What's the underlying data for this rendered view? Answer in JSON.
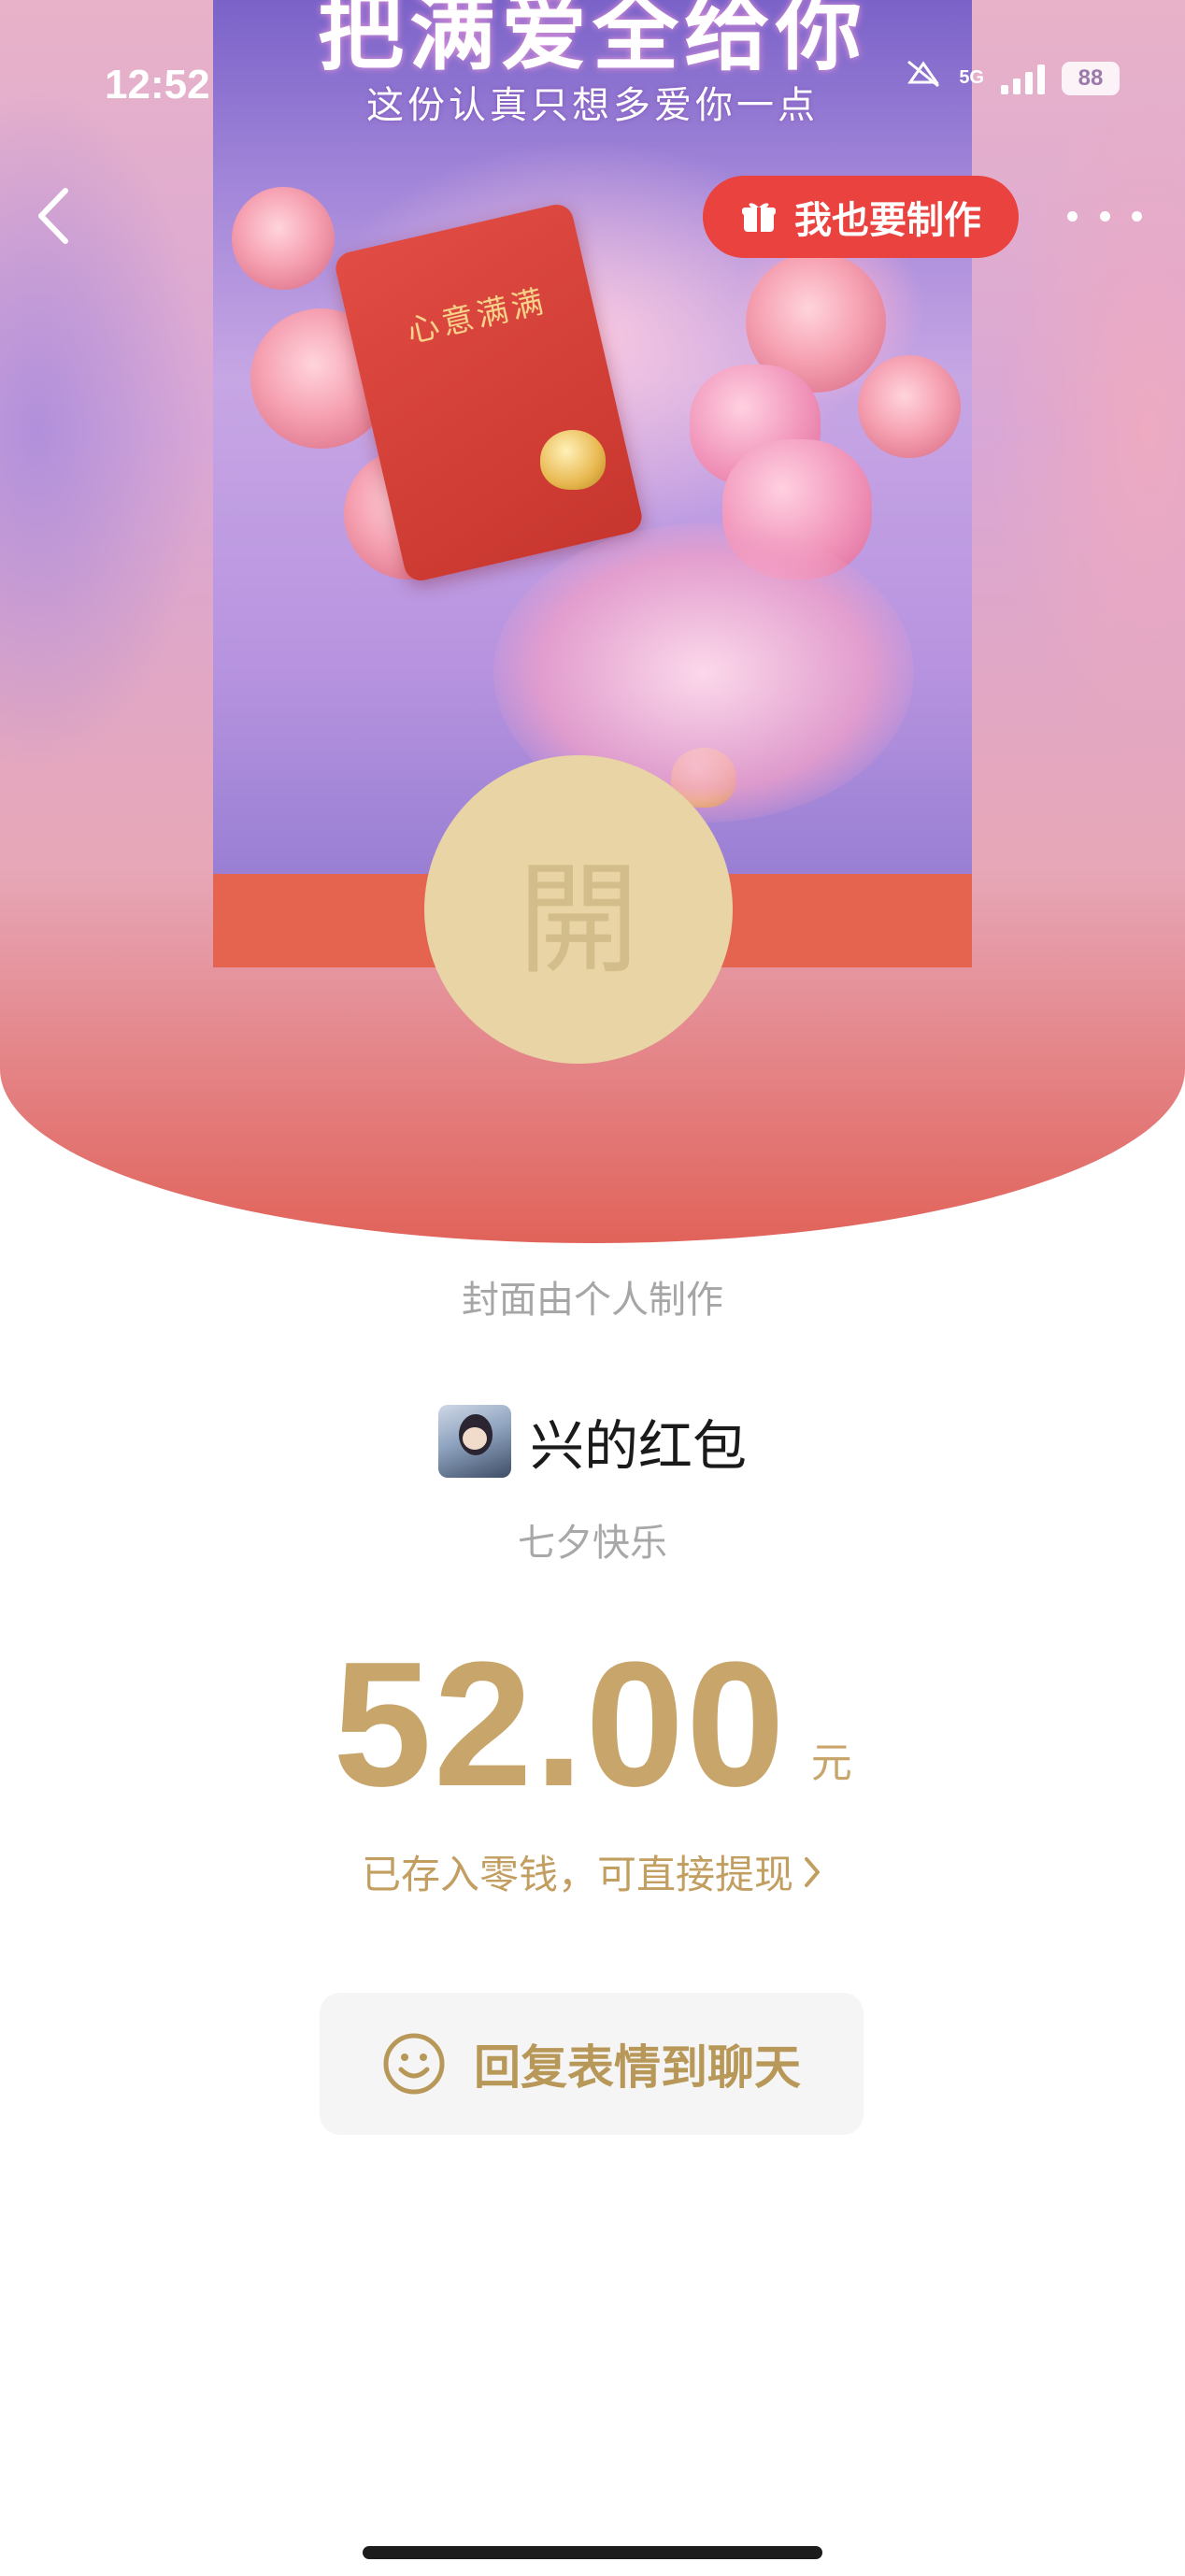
{
  "status_bar": {
    "time": "12:52",
    "network": "5G",
    "battery": "88"
  },
  "cover": {
    "title_top": "把满爱全给你",
    "subtitle": "这份认真只想多爱你一点",
    "card_text": "心意满满",
    "open_label": "開"
  },
  "nav": {
    "make_button_label": "我也要制作"
  },
  "content": {
    "cover_note": "封面由个人制作",
    "sender_name": "兴的红包",
    "greeting": "七夕快乐",
    "amount": "52.00",
    "unit": "元",
    "wallet_link": "已存入零钱，可直接提现",
    "reply_button": "回复表情到聊天"
  },
  "colors": {
    "accent_red": "#e9423f",
    "gold_text": "#c8a56a",
    "envelope_red": "#e5644f",
    "open_button": "#e8d4a4"
  },
  "icons": {
    "back": "chevron-left-icon",
    "make": "gift-icon",
    "more": "more-dots-icon",
    "wallet": "chevron-right-icon",
    "reply": "smile-icon"
  }
}
